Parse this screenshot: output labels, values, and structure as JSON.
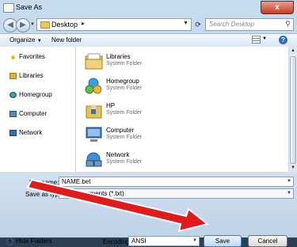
{
  "window": {
    "title": "Save As",
    "close_glyph": "x"
  },
  "address": {
    "location": "Desktop",
    "separator": "▸"
  },
  "search": {
    "placeholder": "Search Desktop"
  },
  "toolbar": {
    "organize_label": "Organize",
    "new_folder_label": "New folder",
    "help_glyph": "?"
  },
  "nav_pane": {
    "items": [
      {
        "label": "Favorites",
        "icon": "star-icon"
      },
      {
        "label": "Libraries",
        "icon": "library-icon"
      },
      {
        "label": "Homegroup",
        "icon": "homegroup-icon"
      },
      {
        "label": "Computer",
        "icon": "computer-icon"
      },
      {
        "label": "Network",
        "icon": "network-icon"
      }
    ]
  },
  "files": [
    {
      "name": "Libraries",
      "type": "System Folder",
      "icon": "libraries-icon"
    },
    {
      "name": "Homegroup",
      "type": "System Folder",
      "icon": "homegroup-icon"
    },
    {
      "name": "HP",
      "type": "System Folder",
      "icon": "user-folder-icon"
    },
    {
      "name": "Computer",
      "type": "System Folder",
      "icon": "computer-icon"
    },
    {
      "name": "Network",
      "type": "System Folder",
      "icon": "network-icon"
    }
  ],
  "form": {
    "file_name_label": "File name:",
    "file_name_value": "NAME.bet",
    "save_as_type_label": "Save as type:",
    "save_as_type_value": "Text Documents (*.txt)",
    "encoding_label": "Encoding:",
    "encoding_value": "ANSI"
  },
  "footer": {
    "hide_folders_label": "Hide Folders",
    "save_label": "Save",
    "cancel_label": "Cancel"
  },
  "colors": {
    "accent_arrow": "#e01b1b",
    "selection_blue": "#3a7bd5"
  }
}
